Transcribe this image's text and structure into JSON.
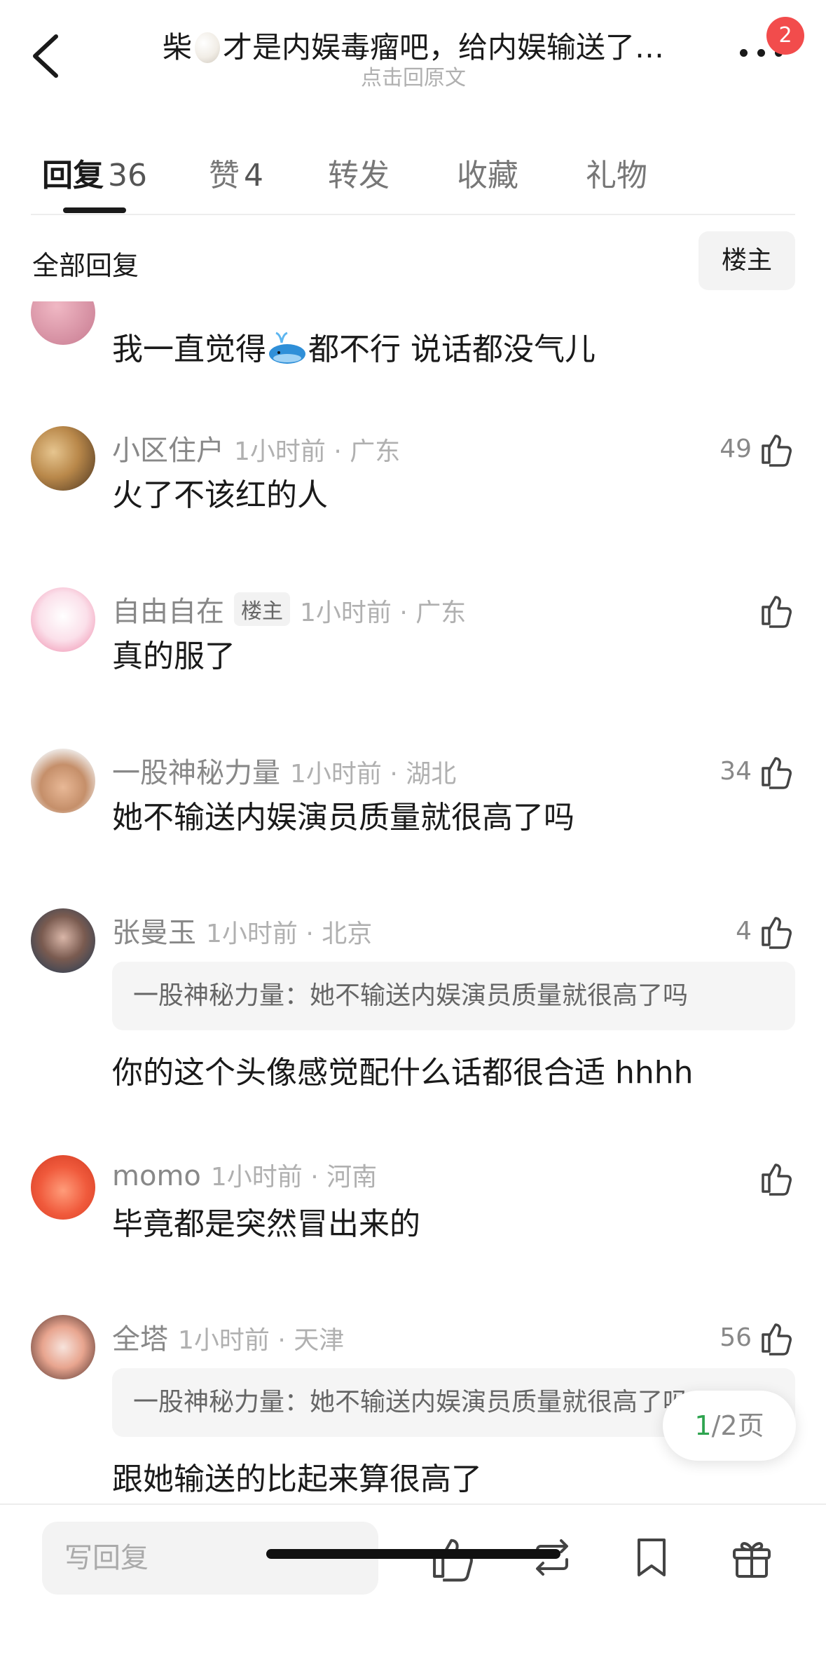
{
  "header": {
    "title_prefix": "柴",
    "title_suffix": "才是内娱毒瘤吧，给内娱输送了…",
    "subtitle": "点击回原文",
    "notification_count": "2"
  },
  "tabs": [
    {
      "label": "回复",
      "count": "36",
      "active": true
    },
    {
      "label": "赞",
      "count": "4"
    },
    {
      "label": "转发",
      "count": ""
    },
    {
      "label": "收藏",
      "count": ""
    },
    {
      "label": "礼物",
      "count": ""
    }
  ],
  "filter": {
    "label": "全部回复",
    "op_button": "楼主"
  },
  "comments": [
    {
      "text_before": "我一直觉得",
      "text_after": "都不行 说话都没气儿"
    },
    {
      "user": "小区住户",
      "time": "1小时前 · 广东",
      "likes": "49",
      "text": "火了不该红的人"
    },
    {
      "user": "自由自在",
      "badge": "楼主",
      "time": "1小时前 · 广东",
      "likes": "",
      "text": "真的服了"
    },
    {
      "user": "一股神秘力量",
      "time": "1小时前 · 湖北",
      "likes": "34",
      "text": "她不输送内娱演员质量就很高了吗"
    },
    {
      "user": "张曼玉",
      "time": "1小时前 · 北京",
      "likes": "4",
      "quote": "一股神秘力量：她不输送内娱演员质量就很高了吗",
      "text": "你的这个头像感觉配什么话都很合适 hhhh"
    },
    {
      "user": "momo",
      "time": "1小时前 · 河南",
      "likes": "",
      "text": "毕竟都是突然冒出来的"
    },
    {
      "user": "全塔",
      "time": "1小时前 · 天津",
      "likes": "56",
      "quote": "一股神秘力量：她不输送内娱演员质量就很高了吗",
      "text": "跟她输送的比起来算很高了"
    }
  ],
  "pagination": {
    "current": "1",
    "total": "/2页"
  },
  "bottom_bar": {
    "placeholder": "写回复"
  },
  "icons": [
    "back-icon",
    "more-icon",
    "thumbs-up-icon",
    "repost-icon",
    "bookmark-icon",
    "gift-icon"
  ]
}
